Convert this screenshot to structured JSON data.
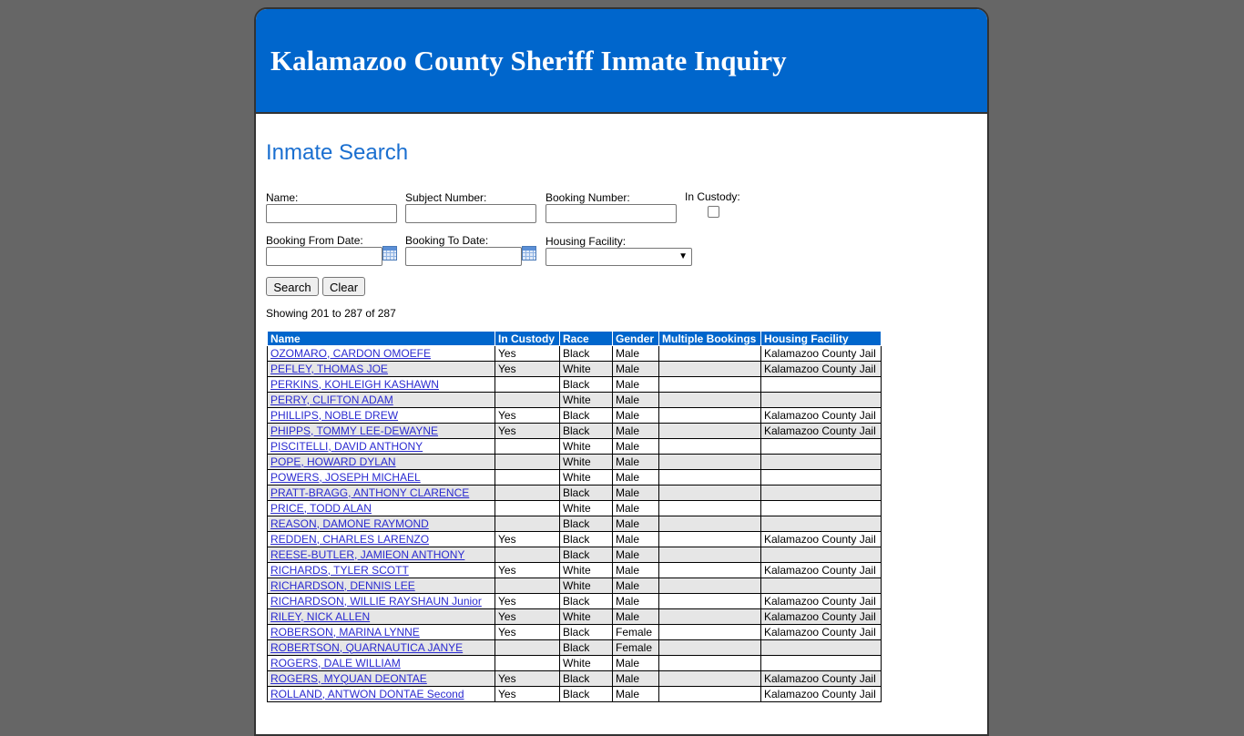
{
  "header": {
    "title": "Kalamazoo County Sheriff Inmate Inquiry"
  },
  "search": {
    "title": "Inmate Search",
    "name_label": "Name:",
    "subject_label": "Subject Number:",
    "booking_label": "Booking Number:",
    "custody_label": "In Custody:",
    "from_label": "Booking From Date:",
    "to_label": "Booking To Date:",
    "facility_label": "Housing Facility:",
    "name_value": "",
    "subject_value": "",
    "booking_value": "",
    "from_value": "",
    "to_value": "",
    "facility_value": "",
    "custody_checked": false,
    "search_button": "Search",
    "clear_button": "Clear"
  },
  "results": {
    "showing": "Showing 201 to 287 of 287",
    "columns": [
      "Name",
      "In Custody",
      "Race",
      "Gender",
      "Multiple Bookings",
      "Housing Facility"
    ],
    "rows": [
      [
        "OZOMARO, CARDON OMOEFE",
        "Yes",
        "Black",
        "Male",
        "",
        "Kalamazoo County Jail"
      ],
      [
        "PEFLEY, THOMAS JOE",
        "Yes",
        "White",
        "Male",
        "",
        "Kalamazoo County Jail"
      ],
      [
        "PERKINS, KOHLEIGH KASHAWN",
        "",
        "Black",
        "Male",
        "",
        ""
      ],
      [
        "PERRY, CLIFTON ADAM",
        "",
        "White",
        "Male",
        "",
        ""
      ],
      [
        "PHILLIPS, NOBLE DREW",
        "Yes",
        "Black",
        "Male",
        "",
        "Kalamazoo County Jail"
      ],
      [
        "PHIPPS, TOMMY LEE-DEWAYNE",
        "Yes",
        "Black",
        "Male",
        "",
        "Kalamazoo County Jail"
      ],
      [
        "PISCITELLI, DAVID ANTHONY",
        "",
        "White",
        "Male",
        "",
        ""
      ],
      [
        "POPE, HOWARD DYLAN",
        "",
        "White",
        "Male",
        "",
        ""
      ],
      [
        "POWERS, JOSEPH MICHAEL",
        "",
        "White",
        "Male",
        "",
        ""
      ],
      [
        "PRATT-BRAGG, ANTHONY CLARENCE",
        "",
        "Black",
        "Male",
        "",
        ""
      ],
      [
        "PRICE, TODD ALAN",
        "",
        "White",
        "Male",
        "",
        ""
      ],
      [
        "REASON, DAMONE RAYMOND",
        "",
        "Black",
        "Male",
        "",
        ""
      ],
      [
        "REDDEN, CHARLES LARENZO",
        "Yes",
        "Black",
        "Male",
        "",
        "Kalamazoo County Jail"
      ],
      [
        "REESE-BUTLER, JAMIEON ANTHONY",
        "",
        "Black",
        "Male",
        "",
        ""
      ],
      [
        "RICHARDS, TYLER SCOTT",
        "Yes",
        "White",
        "Male",
        "",
        "Kalamazoo County Jail"
      ],
      [
        "RICHARDSON, DENNIS LEE",
        "",
        "White",
        "Male",
        "",
        ""
      ],
      [
        "RICHARDSON, WILLIE RAYSHAUN Junior",
        "Yes",
        "Black",
        "Male",
        "",
        "Kalamazoo County Jail"
      ],
      [
        "RILEY, NICK ALLEN",
        "Yes",
        "White",
        "Male",
        "",
        "Kalamazoo County Jail"
      ],
      [
        "ROBERSON, MARINA LYNNE",
        "Yes",
        "Black",
        "Female",
        "",
        "Kalamazoo County Jail"
      ],
      [
        "ROBERTSON, QUARNAUTICA JANYE",
        "",
        "Black",
        "Female",
        "",
        ""
      ],
      [
        "ROGERS, DALE WILLIAM",
        "",
        "White",
        "Male",
        "",
        ""
      ],
      [
        "ROGERS, MYQUAN DEONTAE",
        "Yes",
        "Black",
        "Male",
        "",
        "Kalamazoo County Jail"
      ],
      [
        "ROLLAND, ANTWON DONTAE Second",
        "Yes",
        "Black",
        "Male",
        "",
        "Kalamazoo County Jail"
      ]
    ]
  }
}
